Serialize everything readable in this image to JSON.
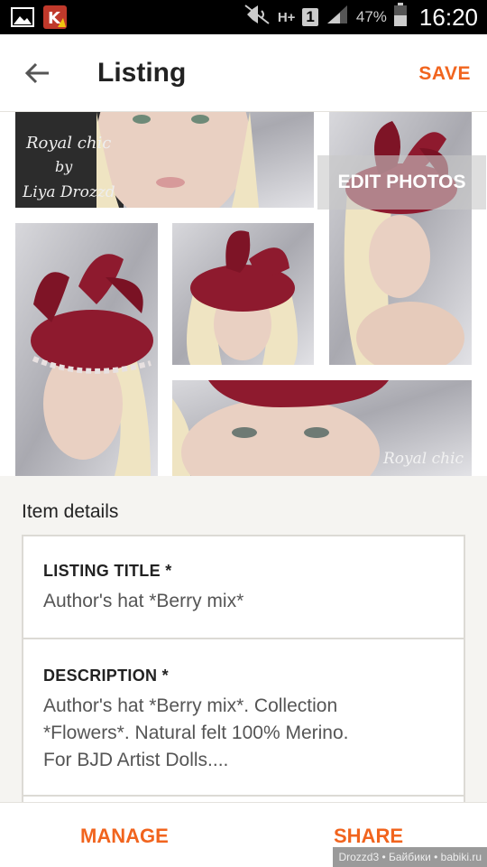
{
  "status_bar": {
    "network": "H+",
    "sim": "1",
    "battery": "47%",
    "time": "16:20",
    "icons": [
      "image-icon",
      "k-app-icon",
      "mute-icon",
      "network-icon",
      "sim-icon",
      "signal-icon",
      "battery-icon"
    ]
  },
  "app_bar": {
    "title": "Listing",
    "save_label": "SAVE",
    "back_icon": "arrow-left-icon"
  },
  "photos": {
    "edit_label": "EDIT PHOTOS",
    "watermark_top": "Royal chic\nby\nLiya Drozzd",
    "watermark_bottom": "Royal chic"
  },
  "details": {
    "heading": "Item details",
    "title_label": "LISTING TITLE *",
    "title_value": "Author's hat *Berry mix*",
    "description_label": "DESCRIPTION *",
    "description_value": "Author's hat *Berry mix*. Collection\n*Flowers*. Natural felt 100% Merino.\nFor BJD Artist Dolls...."
  },
  "bottom_bar": {
    "manage_label": "MANAGE",
    "share_label": "SHARE",
    "watermark": "Drozzd3 • Байбики • babiki.ru"
  },
  "colors": {
    "accent": "#f1641e",
    "background": "#f5f4f1",
    "hat": "#8e1a2e"
  }
}
